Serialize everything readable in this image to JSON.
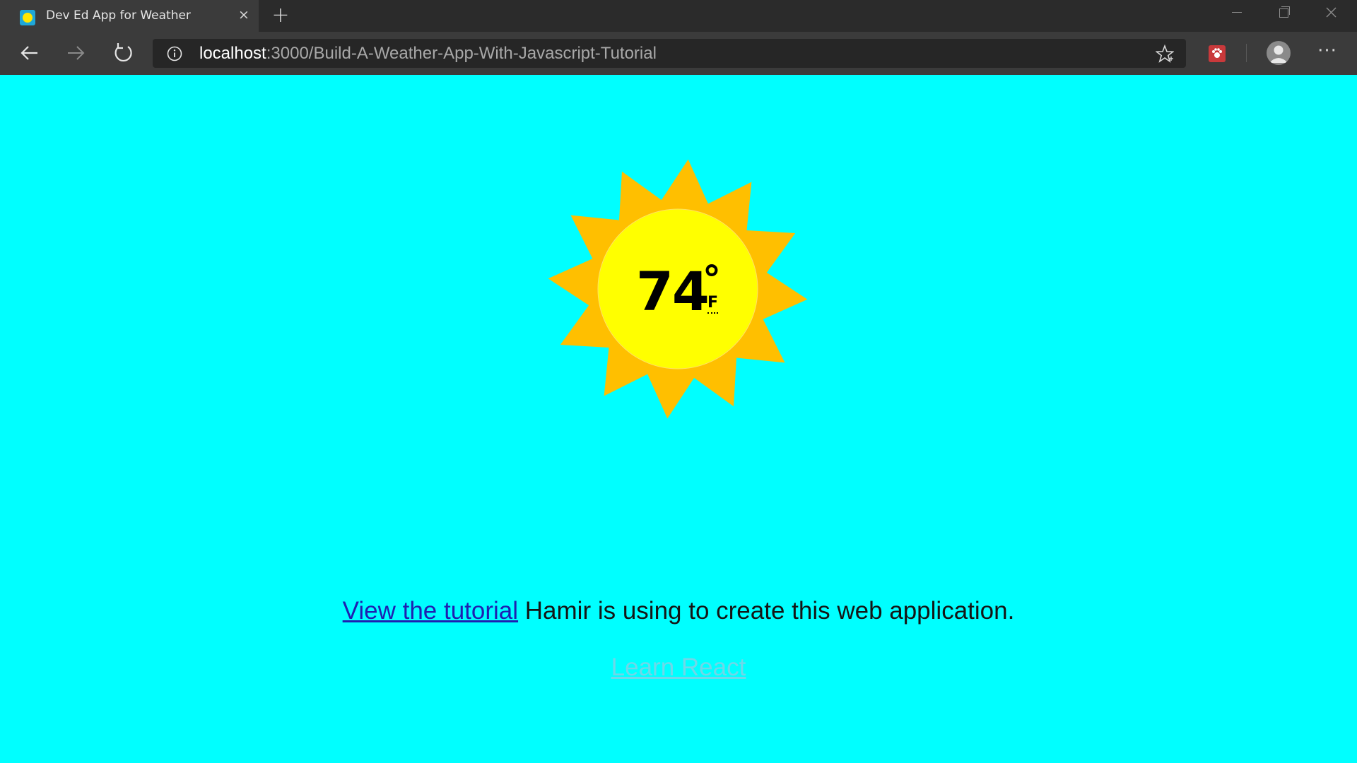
{
  "browser": {
    "tab_title": "Dev Ed App for Weather",
    "tab_close_glyph": "×",
    "new_tab_glyph": "+",
    "url_host": "localhost",
    "url_path": ":3000/Build-A-Weather-App-With-Javascript-Tutorial",
    "more_glyph": "···",
    "icons": [
      "back-arrow-icon",
      "forward-arrow-icon",
      "refresh-icon",
      "info-icon",
      "star-icon",
      "extension-icon",
      "profile-icon",
      "more-icon"
    ]
  },
  "weather": {
    "temperature": "74",
    "degree_symbol": "°",
    "unit": "F",
    "icon": "sun-icon"
  },
  "footer": {
    "tutorial_link": "View the tutorial",
    "tutorial_text": " Hamir is using to create this web application.",
    "learn_react": "Learn React"
  },
  "colors": {
    "page_background": "#00ffff",
    "sun_rays": "#ffbf00",
    "sun_core": "#ffff00",
    "tutorial_link": "#1f1fb0",
    "learn_react_link": "#6fd8e8"
  }
}
